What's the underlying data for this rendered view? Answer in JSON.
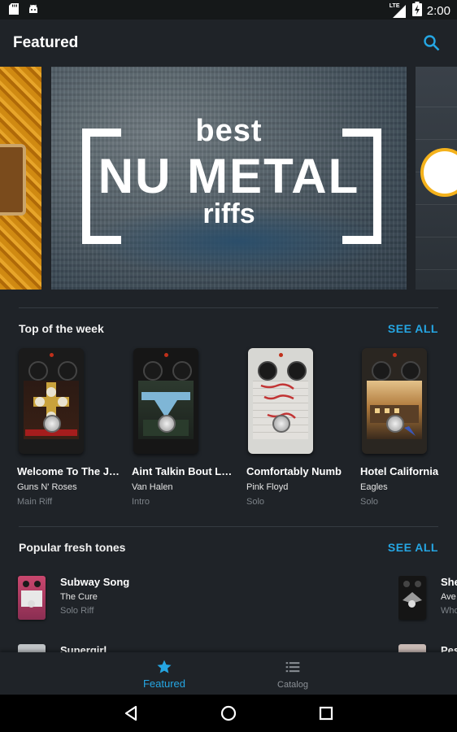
{
  "status_bar": {
    "time": "2:00",
    "network": "LTE"
  },
  "app_bar": {
    "title": "Featured",
    "search_icon": "search-icon"
  },
  "banner": {
    "line1": "best",
    "line2": "NU METAL",
    "line3": "riffs"
  },
  "top_of_week": {
    "title": "Top of the week",
    "see_all": "SEE ALL",
    "items": [
      {
        "title": "Welcome To The J…",
        "artist": "Guns N' Roses",
        "part": "Main Riff"
      },
      {
        "title": "Aint Talkin Bout L…",
        "artist": "Van Halen",
        "part": "Intro"
      },
      {
        "title": "Comfortably Numb",
        "artist": "Pink Floyd",
        "part": "Solo"
      },
      {
        "title": "Hotel California",
        "artist": "Eagles",
        "part": "Solo"
      }
    ]
  },
  "fresh_tones": {
    "title": "Popular fresh tones",
    "see_all": "SEE ALL",
    "items": [
      {
        "title": "Subway Song",
        "artist": "The Cure",
        "part": "Solo Riff"
      },
      {
        "title": "She",
        "artist": "Ave",
        "part": "Who"
      },
      {
        "title": "Supergirl",
        "artist": "",
        "part": ""
      },
      {
        "title": "Pes",
        "artist": "",
        "part": ""
      }
    ]
  },
  "bottom_nav": {
    "featured": "Featured",
    "catalog": "Catalog",
    "active_color": "#25a6e3",
    "inactive_color": "#8b9096"
  },
  "colors": {
    "accent": "#25a6e3",
    "background": "#1f2328"
  }
}
